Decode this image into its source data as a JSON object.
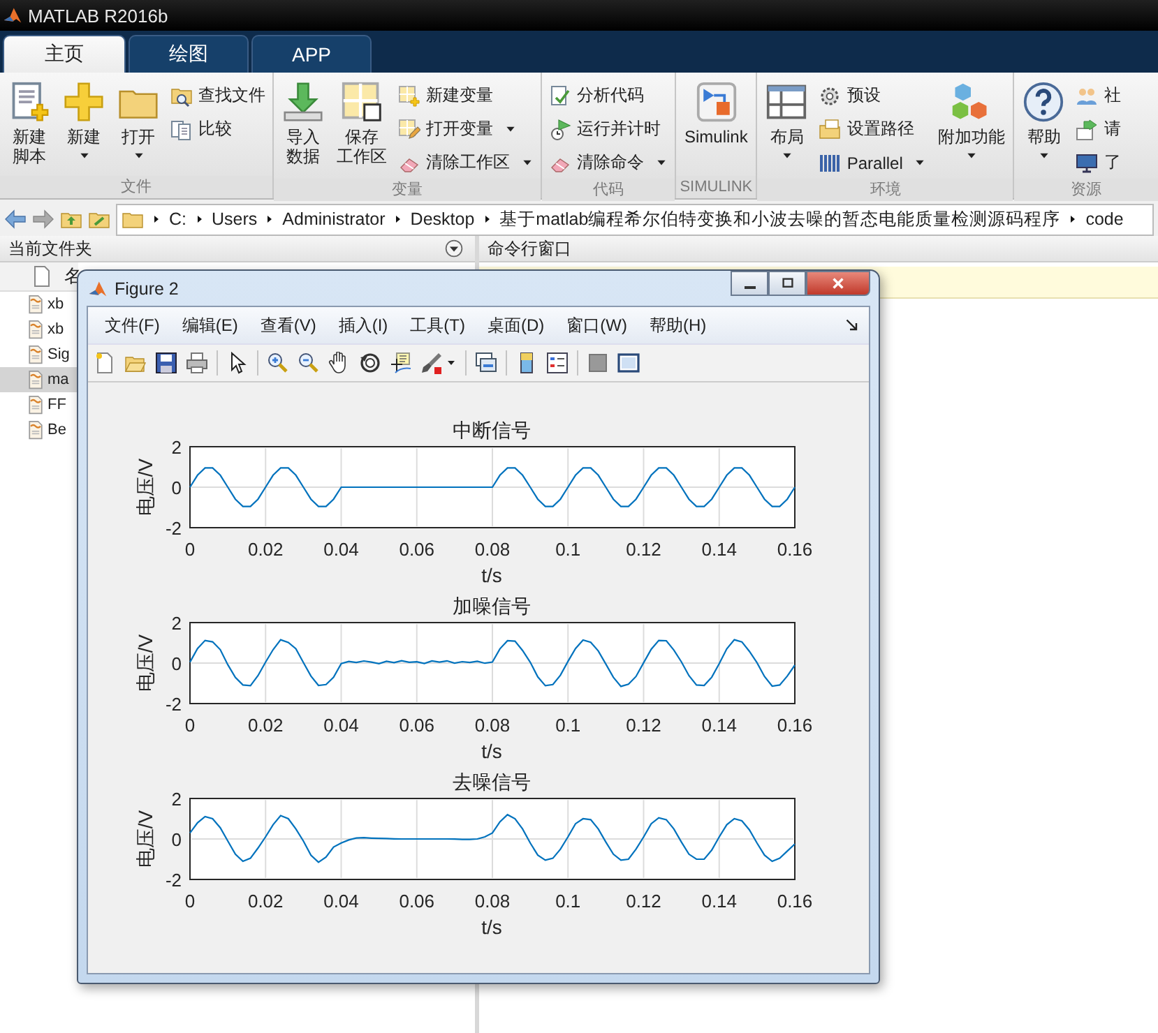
{
  "window": {
    "title": "MATLAB R2016b"
  },
  "tabs": [
    {
      "label": "主页",
      "selected": true
    },
    {
      "label": "绘图",
      "selected": false
    },
    {
      "label": "APP",
      "selected": false
    }
  ],
  "toolstrip": {
    "sections": [
      {
        "label": "文件",
        "items": [
          {
            "kind": "large",
            "lines": [
              "新建",
              "脚本"
            ],
            "dropdown": false
          },
          {
            "kind": "large",
            "lines": [
              "新建"
            ],
            "dropdown": true
          },
          {
            "kind": "large",
            "lines": [
              "打开"
            ],
            "dropdown": true
          },
          {
            "kind": "small",
            "label": "查找文件",
            "dropdown": false
          },
          {
            "kind": "small",
            "label": "比较",
            "dropdown": false
          }
        ]
      },
      {
        "label": "变量",
        "items": [
          {
            "kind": "large",
            "lines": [
              "导入",
              "数据"
            ],
            "dropdown": false
          },
          {
            "kind": "large",
            "lines": [
              "保存",
              "工作区"
            ],
            "dropdown": false
          },
          {
            "kind": "small",
            "label": "新建变量",
            "dropdown": false
          },
          {
            "kind": "small",
            "label": "打开变量",
            "dropdown": true
          },
          {
            "kind": "small",
            "label": "清除工作区",
            "dropdown": true
          }
        ]
      },
      {
        "label": "代码",
        "items": [
          {
            "kind": "small",
            "label": "分析代码",
            "dropdown": false
          },
          {
            "kind": "small",
            "label": "运行并计时",
            "dropdown": false
          },
          {
            "kind": "small",
            "label": "清除命令",
            "dropdown": true
          }
        ]
      },
      {
        "label": "SIMULINK",
        "items": [
          {
            "kind": "large",
            "lines": [
              "Simulink"
            ],
            "dropdown": false
          }
        ]
      },
      {
        "label": "环境",
        "items": [
          {
            "kind": "large",
            "lines": [
              "布局"
            ],
            "dropdown": true
          },
          {
            "kind": "small",
            "label": "预设",
            "dropdown": false
          },
          {
            "kind": "small",
            "label": "设置路径",
            "dropdown": false
          },
          {
            "kind": "small",
            "label": "Parallel",
            "dropdown": true
          },
          {
            "kind": "large",
            "lines": [
              "附加功能"
            ],
            "dropdown": true
          }
        ]
      },
      {
        "label": "资源",
        "items": [
          {
            "kind": "large",
            "lines": [
              "帮助"
            ],
            "dropdown": true
          },
          {
            "kind": "small",
            "label": "社",
            "dropdown": false
          },
          {
            "kind": "small",
            "label": "请",
            "dropdown": false
          },
          {
            "kind": "small",
            "label": "了",
            "dropdown": false
          }
        ]
      }
    ]
  },
  "path_bar": {
    "crumbs": [
      "C:",
      "Users",
      "Administrator",
      "Desktop",
      "基于matlab编程希尔伯特变换和小波去噪的暂态电能质量检测源码程序",
      "code"
    ]
  },
  "current_folder": {
    "title": "当前文件夹",
    "column_header": "名",
    "files": [
      {
        "name": "xb",
        "selected": false
      },
      {
        "name": "xb",
        "selected": false
      },
      {
        "name": "Sig",
        "selected": false
      },
      {
        "name": "ma",
        "selected": true
      },
      {
        "name": "FF",
        "selected": false
      },
      {
        "name": "Be",
        "selected": false
      }
    ]
  },
  "command_window": {
    "title": "命令行窗口"
  },
  "figure": {
    "title": "Figure 2",
    "menu": [
      "文件(F)",
      "编辑(E)",
      "查看(V)",
      "插入(I)",
      "工具(T)",
      "桌面(D)",
      "窗口(W)",
      "帮助(H)"
    ],
    "plots": [
      {
        "chart_data": {
          "type": "line",
          "grid": true,
          "title": "中断信号",
          "xlabel": "t/s",
          "ylabel": "电压/V",
          "xlim": [
            0,
            0.16
          ],
          "ylim": [
            -2,
            2
          ],
          "xticks": [
            0,
            0.02,
            0.04,
            0.06,
            0.08,
            0.1,
            0.12,
            0.14,
            0.16
          ],
          "yticks": [
            -2,
            0,
            2
          ],
          "x": [
            0,
            0.002,
            0.004,
            0.006,
            0.008,
            0.01,
            0.012,
            0.014,
            0.016,
            0.018,
            0.02,
            0.022,
            0.024,
            0.026,
            0.028,
            0.03,
            0.032,
            0.034,
            0.036,
            0.038,
            0.04,
            0.042,
            0.044,
            0.046,
            0.048,
            0.05,
            0.052,
            0.054,
            0.056,
            0.058,
            0.06,
            0.062,
            0.064,
            0.066,
            0.068,
            0.07,
            0.072,
            0.074,
            0.076,
            0.078,
            0.08,
            0.082,
            0.084,
            0.086,
            0.088,
            0.09,
            0.092,
            0.094,
            0.096,
            0.098,
            0.1,
            0.102,
            0.104,
            0.106,
            0.108,
            0.11,
            0.112,
            0.114,
            0.116,
            0.118,
            0.12,
            0.122,
            0.124,
            0.126,
            0.128,
            0.13,
            0.132,
            0.134,
            0.136,
            0.138,
            0.14,
            0.142,
            0.144,
            0.146,
            0.148,
            0.15,
            0.152,
            0.154,
            0.156,
            0.158,
            0.16
          ],
          "values": [
            0,
            0.59,
            0.95,
            0.95,
            0.59,
            0,
            -0.59,
            -0.95,
            -0.95,
            -0.59,
            0,
            0.59,
            0.95,
            0.95,
            0.59,
            0,
            -0.59,
            -0.95,
            -0.95,
            -0.59,
            0,
            0,
            0,
            0,
            0,
            0,
            0,
            0,
            0,
            0,
            0,
            0,
            0,
            0,
            0,
            0,
            0,
            0,
            0,
            0,
            0,
            0.59,
            0.95,
            0.95,
            0.59,
            0,
            -0.59,
            -0.95,
            -0.95,
            -0.59,
            0,
            0.59,
            0.95,
            0.95,
            0.59,
            0,
            -0.59,
            -0.95,
            -0.95,
            -0.59,
            0,
            0.59,
            0.95,
            0.95,
            0.59,
            0,
            -0.59,
            -0.95,
            -0.95,
            -0.59,
            0,
            0.59,
            0.95,
            0.95,
            0.59,
            0,
            -0.59,
            -0.95,
            -0.95,
            -0.59,
            0
          ]
        }
      },
      {
        "chart_data": {
          "type": "line",
          "grid": true,
          "title": "加噪信号",
          "xlabel": "t/s",
          "ylabel": "电压/V",
          "xlim": [
            0,
            0.16
          ],
          "ylim": [
            -2,
            2
          ],
          "xticks": [
            0,
            0.02,
            0.04,
            0.06,
            0.08,
            0.1,
            0.12,
            0.14,
            0.16
          ],
          "yticks": [
            -2,
            0,
            2
          ],
          "x": [
            0,
            0.002,
            0.004,
            0.006,
            0.008,
            0.01,
            0.012,
            0.014,
            0.016,
            0.018,
            0.02,
            0.022,
            0.024,
            0.026,
            0.028,
            0.03,
            0.032,
            0.034,
            0.036,
            0.038,
            0.04,
            0.042,
            0.044,
            0.046,
            0.048,
            0.05,
            0.052,
            0.054,
            0.056,
            0.058,
            0.06,
            0.062,
            0.064,
            0.066,
            0.068,
            0.07,
            0.072,
            0.074,
            0.076,
            0.078,
            0.08,
            0.082,
            0.084,
            0.086,
            0.088,
            0.09,
            0.092,
            0.094,
            0.096,
            0.098,
            0.1,
            0.102,
            0.104,
            0.106,
            0.108,
            0.11,
            0.112,
            0.114,
            0.116,
            0.118,
            0.12,
            0.122,
            0.124,
            0.126,
            0.128,
            0.13,
            0.132,
            0.134,
            0.136,
            0.138,
            0.14,
            0.142,
            0.144,
            0.146,
            0.148,
            0.15,
            0.152,
            0.154,
            0.156,
            0.158,
            0.16
          ],
          "values": [
            0.05,
            0.72,
            1.12,
            1.05,
            0.66,
            -0.08,
            -0.71,
            -1.08,
            -1.12,
            -0.62,
            0.04,
            0.66,
            1.15,
            1.02,
            0.71,
            0.03,
            -0.64,
            -1.1,
            -1.06,
            -0.7,
            -0.02,
            0.08,
            0.03,
            0.1,
            0.05,
            -0.03,
            0.09,
            0.02,
            0.12,
            0.04,
            0.06,
            -0.02,
            0.1,
            0.05,
            0.11,
            0,
            0.07,
            0.03,
            0.09,
            -0.01,
            0.05,
            0.7,
            1.1,
            1.08,
            0.62,
            0.04,
            -0.68,
            -1.12,
            -1.06,
            -0.6,
            0.08,
            0.72,
            1.14,
            1.03,
            0.6,
            -0.05,
            -0.7,
            -1.15,
            -1.04,
            -0.66,
            0.02,
            0.68,
            1.12,
            1.1,
            0.64,
            0.06,
            -0.62,
            -1.08,
            -1.1,
            -0.7,
            -0.03,
            0.7,
            1.15,
            1.05,
            0.58,
            0.02,
            -0.66,
            -1.14,
            -1.08,
            -0.64,
            -0.1
          ]
        }
      },
      {
        "chart_data": {
          "type": "line",
          "grid": true,
          "title": "去噪信号",
          "xlabel": "t/s",
          "ylabel": "电压/V",
          "xlim": [
            0,
            0.16
          ],
          "ylim": [
            -2,
            2
          ],
          "xticks": [
            0,
            0.02,
            0.04,
            0.06,
            0.08,
            0.1,
            0.12,
            0.14,
            0.16
          ],
          "yticks": [
            -2,
            0,
            2
          ],
          "x": [
            0,
            0.002,
            0.004,
            0.006,
            0.008,
            0.01,
            0.012,
            0.014,
            0.016,
            0.018,
            0.02,
            0.022,
            0.024,
            0.026,
            0.028,
            0.03,
            0.032,
            0.034,
            0.036,
            0.038,
            0.04,
            0.042,
            0.044,
            0.046,
            0.048,
            0.05,
            0.052,
            0.054,
            0.056,
            0.058,
            0.06,
            0.062,
            0.064,
            0.066,
            0.068,
            0.07,
            0.072,
            0.074,
            0.076,
            0.078,
            0.08,
            0.082,
            0.084,
            0.086,
            0.088,
            0.09,
            0.092,
            0.094,
            0.096,
            0.098,
            0.1,
            0.102,
            0.104,
            0.106,
            0.108,
            0.11,
            0.112,
            0.114,
            0.116,
            0.118,
            0.12,
            0.122,
            0.124,
            0.126,
            0.128,
            0.13,
            0.132,
            0.134,
            0.136,
            0.138,
            0.14,
            0.142,
            0.144,
            0.146,
            0.148,
            0.15,
            0.152,
            0.154,
            0.156,
            0.158,
            0.16
          ],
          "values": [
            0.3,
            0.8,
            1.1,
            1,
            0.55,
            -0.1,
            -0.75,
            -1.1,
            -0.95,
            -0.45,
            0.1,
            0.7,
            1.15,
            1,
            0.5,
            -0.1,
            -0.8,
            -1.15,
            -0.9,
            -0.4,
            -0.2,
            -0.05,
            0.05,
            0.06,
            0.04,
            0.03,
            0.02,
            0.01,
            0,
            0,
            0,
            0,
            0,
            0,
            0,
            -0.01,
            -0.02,
            -0.02,
            0,
            0.1,
            0.3,
            0.85,
            1.2,
            1,
            0.5,
            -0.2,
            -0.8,
            -1.05,
            -0.95,
            -0.5,
            0.1,
            0.75,
            1,
            0.95,
            0.5,
            -0.15,
            -0.75,
            -1.05,
            -1,
            -0.5,
            0.1,
            0.75,
            1.05,
            0.95,
            0.5,
            -0.15,
            -0.75,
            -1,
            -1,
            -0.55,
            0.1,
            0.7,
            1,
            0.9,
            0.45,
            -0.2,
            -0.8,
            -1.1,
            -0.95,
            -0.6,
            -0.25
          ]
        }
      }
    ]
  }
}
